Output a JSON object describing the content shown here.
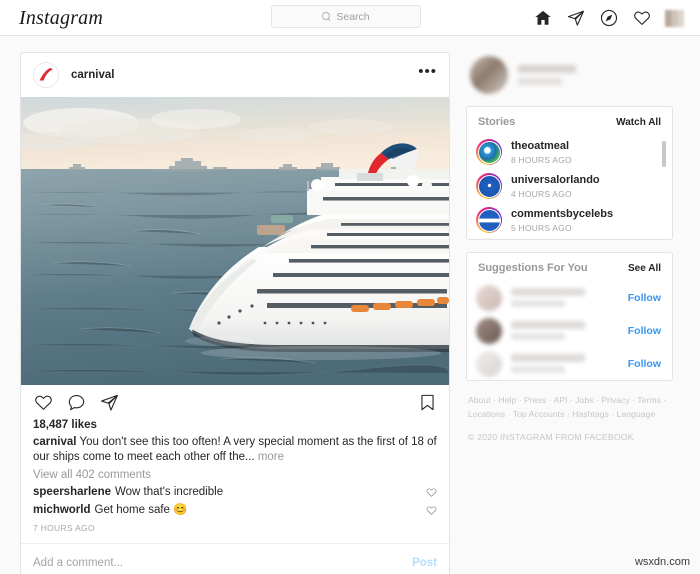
{
  "app": {
    "logo_text": "Instagram"
  },
  "search": {
    "placeholder": "Search",
    "icon": "search-icon"
  },
  "nav": {
    "icons": [
      {
        "name": "home-icon",
        "label": "Home"
      },
      {
        "name": "direct-share-icon",
        "label": "Direct"
      },
      {
        "name": "explore-compass-icon",
        "label": "Explore"
      },
      {
        "name": "activity-heart-icon",
        "label": "Activity"
      },
      {
        "name": "profile-avatar",
        "label": "Profile"
      }
    ]
  },
  "post": {
    "username": "carnival",
    "avatar_icon": "carnival-logo-avatar",
    "more_label": "•••",
    "image_alt": "Carnival cruise ship at sea at sunset",
    "actions": {
      "like": "like-icon",
      "comment": "comment-icon",
      "share": "share-icon",
      "save": "bookmark-icon"
    },
    "likes": "18,487 likes",
    "caption_user": "carnival",
    "caption_text": "You don't see this too often! A very special moment as the first of 18 of our ships come to meet each other off the...",
    "more_link": "more",
    "view_comments": "View all 402 comments",
    "comments": [
      {
        "user": "speersharlene",
        "text": "Wow that's incredible"
      },
      {
        "user": "michworld",
        "text": "Get home safe 😊"
      }
    ],
    "time_ago": "7 HOURS AGO",
    "add_comment_placeholder": "Add a comment...",
    "post_button": "Post"
  },
  "sidebar": {
    "stories": {
      "title": "Stories",
      "action": "Watch All",
      "items": [
        {
          "name": "theoatmeal",
          "time": "8 HOURS AGO"
        },
        {
          "name": "universalorlando",
          "time": "4 HOURS AGO"
        },
        {
          "name": "commentsbycelebs",
          "time": "5 HOURS AGO"
        }
      ]
    },
    "suggestions": {
      "title": "Suggestions For You",
      "action": "See All",
      "items": [
        {
          "follow": "Follow"
        },
        {
          "follow": "Follow"
        },
        {
          "follow": "Follow"
        }
      ]
    },
    "footer": {
      "links_line1": "About · Help · Press · API · Jobs · Privacy · Terms ·",
      "links_line2": "Locations · Top Accounts · Hashtags · Language",
      "copyright": "© 2020 INSTAGRAM FROM FACEBOOK"
    }
  },
  "watermark": {
    "text": "wsxdn.com"
  },
  "colors": {
    "accent_blue": "#3897f0",
    "post_button_blue": "#b2dffc",
    "background": "#fafafa",
    "border": "#e3e3e3",
    "text": "#262626",
    "muted": "#999999"
  }
}
